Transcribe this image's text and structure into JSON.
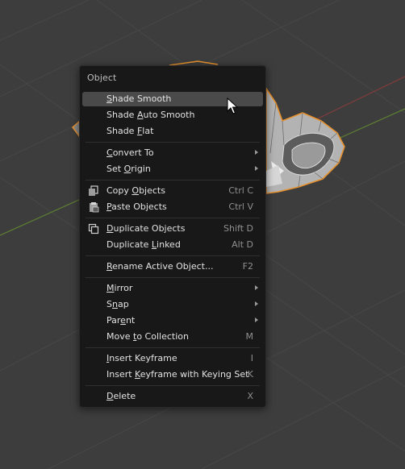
{
  "menu": {
    "title": "Object",
    "items": [
      {
        "pre": "",
        "u": "S",
        "post": "hade Smooth",
        "shortcut": "",
        "submenu": false,
        "highlighted": true,
        "icon": ""
      },
      {
        "pre": "Shade ",
        "u": "A",
        "post": "uto Smooth",
        "shortcut": "",
        "submenu": false,
        "highlighted": false,
        "icon": ""
      },
      {
        "pre": "Shade ",
        "u": "F",
        "post": "lat",
        "shortcut": "",
        "submenu": false,
        "highlighted": false,
        "icon": ""
      },
      {
        "pre": "",
        "u": "C",
        "post": "onvert To",
        "shortcut": "",
        "submenu": true,
        "highlighted": false,
        "icon": ""
      },
      {
        "pre": "Set ",
        "u": "O",
        "post": "rigin",
        "shortcut": "",
        "submenu": true,
        "highlighted": false,
        "icon": ""
      },
      {
        "pre": "Copy ",
        "u": "O",
        "post": "bjects",
        "shortcut": "Ctrl C",
        "submenu": false,
        "highlighted": false,
        "icon": "copy-objects-icon"
      },
      {
        "pre": "",
        "u": "P",
        "post": "aste Objects",
        "shortcut": "Ctrl V",
        "submenu": false,
        "highlighted": false,
        "icon": "paste-objects-icon"
      },
      {
        "pre": "",
        "u": "D",
        "post": "uplicate Objects",
        "shortcut": "Shift D",
        "submenu": false,
        "highlighted": false,
        "icon": "duplicate-icon"
      },
      {
        "pre": "Duplicate ",
        "u": "L",
        "post": "inked",
        "shortcut": "Alt D",
        "submenu": false,
        "highlighted": false,
        "icon": ""
      },
      {
        "pre": "",
        "u": "R",
        "post": "ename Active Object...",
        "shortcut": "F2",
        "submenu": false,
        "highlighted": false,
        "icon": ""
      },
      {
        "pre": "",
        "u": "M",
        "post": "irror",
        "shortcut": "",
        "submenu": true,
        "highlighted": false,
        "icon": ""
      },
      {
        "pre": "S",
        "u": "n",
        "post": "ap",
        "shortcut": "",
        "submenu": true,
        "highlighted": false,
        "icon": ""
      },
      {
        "pre": "Par",
        "u": "e",
        "post": "nt",
        "shortcut": "",
        "submenu": true,
        "highlighted": false,
        "icon": ""
      },
      {
        "pre": "Move ",
        "u": "t",
        "post": "o Collection",
        "shortcut": "M",
        "submenu": false,
        "highlighted": false,
        "icon": ""
      },
      {
        "pre": "",
        "u": "I",
        "post": "nsert Keyframe",
        "shortcut": "I",
        "submenu": false,
        "highlighted": false,
        "icon": ""
      },
      {
        "pre": "Insert ",
        "u": "K",
        "post": "eyframe with Keying Set",
        "shortcut": "K",
        "submenu": false,
        "highlighted": false,
        "icon": ""
      },
      {
        "pre": "",
        "u": "D",
        "post": "elete",
        "shortcut": "X",
        "submenu": false,
        "highlighted": false,
        "icon": ""
      }
    ]
  },
  "colors": {
    "viewport_bg": "#3d3d3d",
    "grid": "#474747",
    "axis_red": "#7a3c3c",
    "axis_green": "#5a7a33",
    "selection_outline": "#e8922e",
    "menu_bg": "#181818",
    "highlight": "#4a4a4a"
  }
}
